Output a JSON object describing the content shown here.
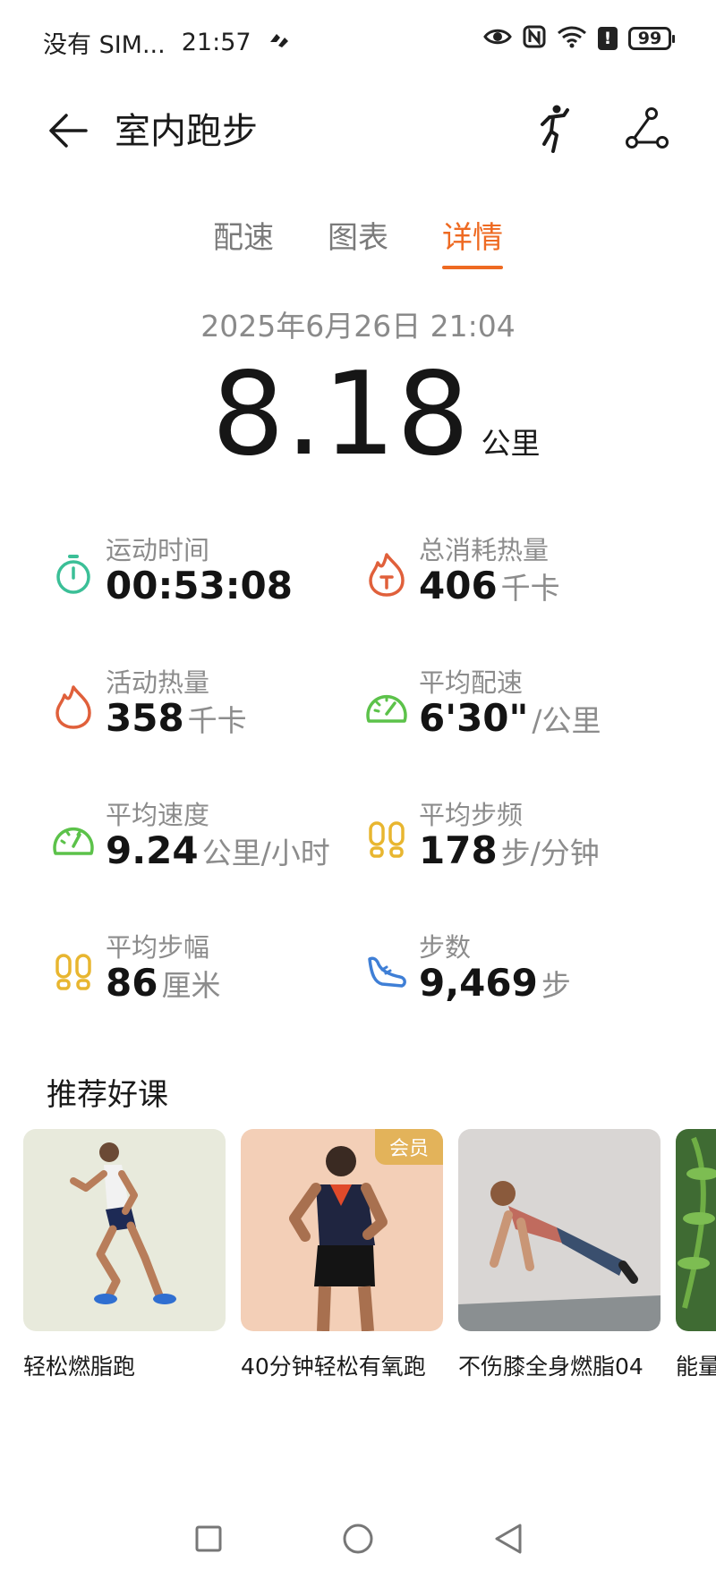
{
  "status_bar": {
    "carrier": "没有 SIM...",
    "time": "21:57",
    "battery": "99",
    "icons": [
      "eye-icon",
      "nfc-icon",
      "wifi-icon",
      "alert-icon",
      "battery-icon"
    ]
  },
  "header": {
    "title": "室内跑步",
    "icons": [
      "back-arrow-icon",
      "running-figure-icon",
      "share-icon"
    ]
  },
  "tabs": [
    {
      "label": "配速",
      "active": false
    },
    {
      "label": "图表",
      "active": false
    },
    {
      "label": "详情",
      "active": true
    }
  ],
  "summary": {
    "datetime": "2025年6月26日 21:04",
    "distance": "8.18",
    "distance_unit": "公里"
  },
  "stats": [
    {
      "label": "运动时间",
      "value": "00:53:08",
      "unit": "",
      "icon": "stopwatch-icon",
      "color": "#3bbf97"
    },
    {
      "label": "总消耗热量",
      "value": "406",
      "unit": "千卡",
      "icon": "flame-total-icon",
      "color": "#e0603b"
    },
    {
      "label": "活动热量",
      "value": "358",
      "unit": "千卡",
      "icon": "flame-icon",
      "color": "#e0603b"
    },
    {
      "label": "平均配速",
      "value": "6'30\"",
      "unit": "/公里",
      "icon": "pace-gauge-icon",
      "color": "#5cc24a"
    },
    {
      "label": "平均速度",
      "value": "9.24",
      "unit": "公里/小时",
      "icon": "speedometer-icon",
      "color": "#5cc24a"
    },
    {
      "label": "平均步频",
      "value": "178",
      "unit": "步/分钟",
      "icon": "footprints-icon",
      "color": "#e8b630"
    },
    {
      "label": "平均步幅",
      "value": "86",
      "unit": "厘米",
      "icon": "footprints-icon",
      "color": "#e8b630"
    },
    {
      "label": "步数",
      "value": "9,469",
      "unit": "步",
      "icon": "shoe-icon",
      "color": "#3f7fd6"
    }
  ],
  "recommend": {
    "title": "推荐好课",
    "courses": [
      {
        "name": "轻松燃脂跑",
        "badge": "",
        "bg": "#e8eadc"
      },
      {
        "name": "40分钟轻松有氧跑",
        "badge": "会员",
        "bg": "#f3cfb7"
      },
      {
        "name": "不伤膝全身燃脂04",
        "badge": "",
        "bg": "#d9d6d4"
      },
      {
        "name": "能量",
        "badge": "",
        "bg": "#3f6b33"
      }
    ]
  },
  "navbar": {
    "icons": [
      "recent-apps-icon",
      "home-icon",
      "back-icon"
    ]
  }
}
